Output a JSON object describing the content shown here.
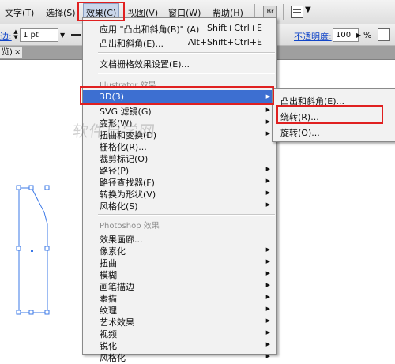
{
  "menubar": {
    "items": [
      "文字(T)",
      "选择(S)",
      "效果(C)",
      "视图(V)",
      "窗口(W)",
      "帮助(H)"
    ],
    "bridge_label": "Br"
  },
  "controlbar": {
    "stroke_label": "边:",
    "stroke_value": "1 pt",
    "opacity_label": "不透明度:",
    "opacity_value": "100",
    "percent": "%"
  },
  "doc_tab": {
    "label": "览)",
    "close": "×"
  },
  "effect_menu": {
    "apply_last": {
      "label": "应用 \"凸出和斜角(B)\" (A)",
      "shortcut": "Shift+Ctrl+E"
    },
    "last_effect": {
      "label": "凸出和斜角(E)...",
      "shortcut": "Alt+Shift+Ctrl+E"
    },
    "document_raster": "文档栅格效果设置(E)...",
    "illustrator_section": "Illustrator 效果",
    "illustrator_items": [
      "3D(3)",
      "SVG 滤镜(G)",
      "变形(W)",
      "扭曲和变换(D)",
      "栅格化(R)...",
      "裁剪标记(O)",
      "路径(P)",
      "路径查找器(F)",
      "转换为形状(V)",
      "风格化(S)"
    ],
    "photoshop_section": "Photoshop 效果",
    "photoshop_items": [
      "效果画廊...",
      "像素化",
      "扭曲",
      "模糊",
      "画笔描边",
      "素描",
      "纹理",
      "艺术效果",
      "视频",
      "锐化",
      "风格化"
    ]
  },
  "submenu_3d": {
    "items": [
      "凸出和斜角(E)...",
      "绕转(R)...",
      "旋转(O)..."
    ]
  },
  "watermark": "软件自学网",
  "colors": {
    "highlight": "#3d6fd1",
    "annotation_red": "#e02020",
    "selection_blue": "#3b78e7"
  }
}
